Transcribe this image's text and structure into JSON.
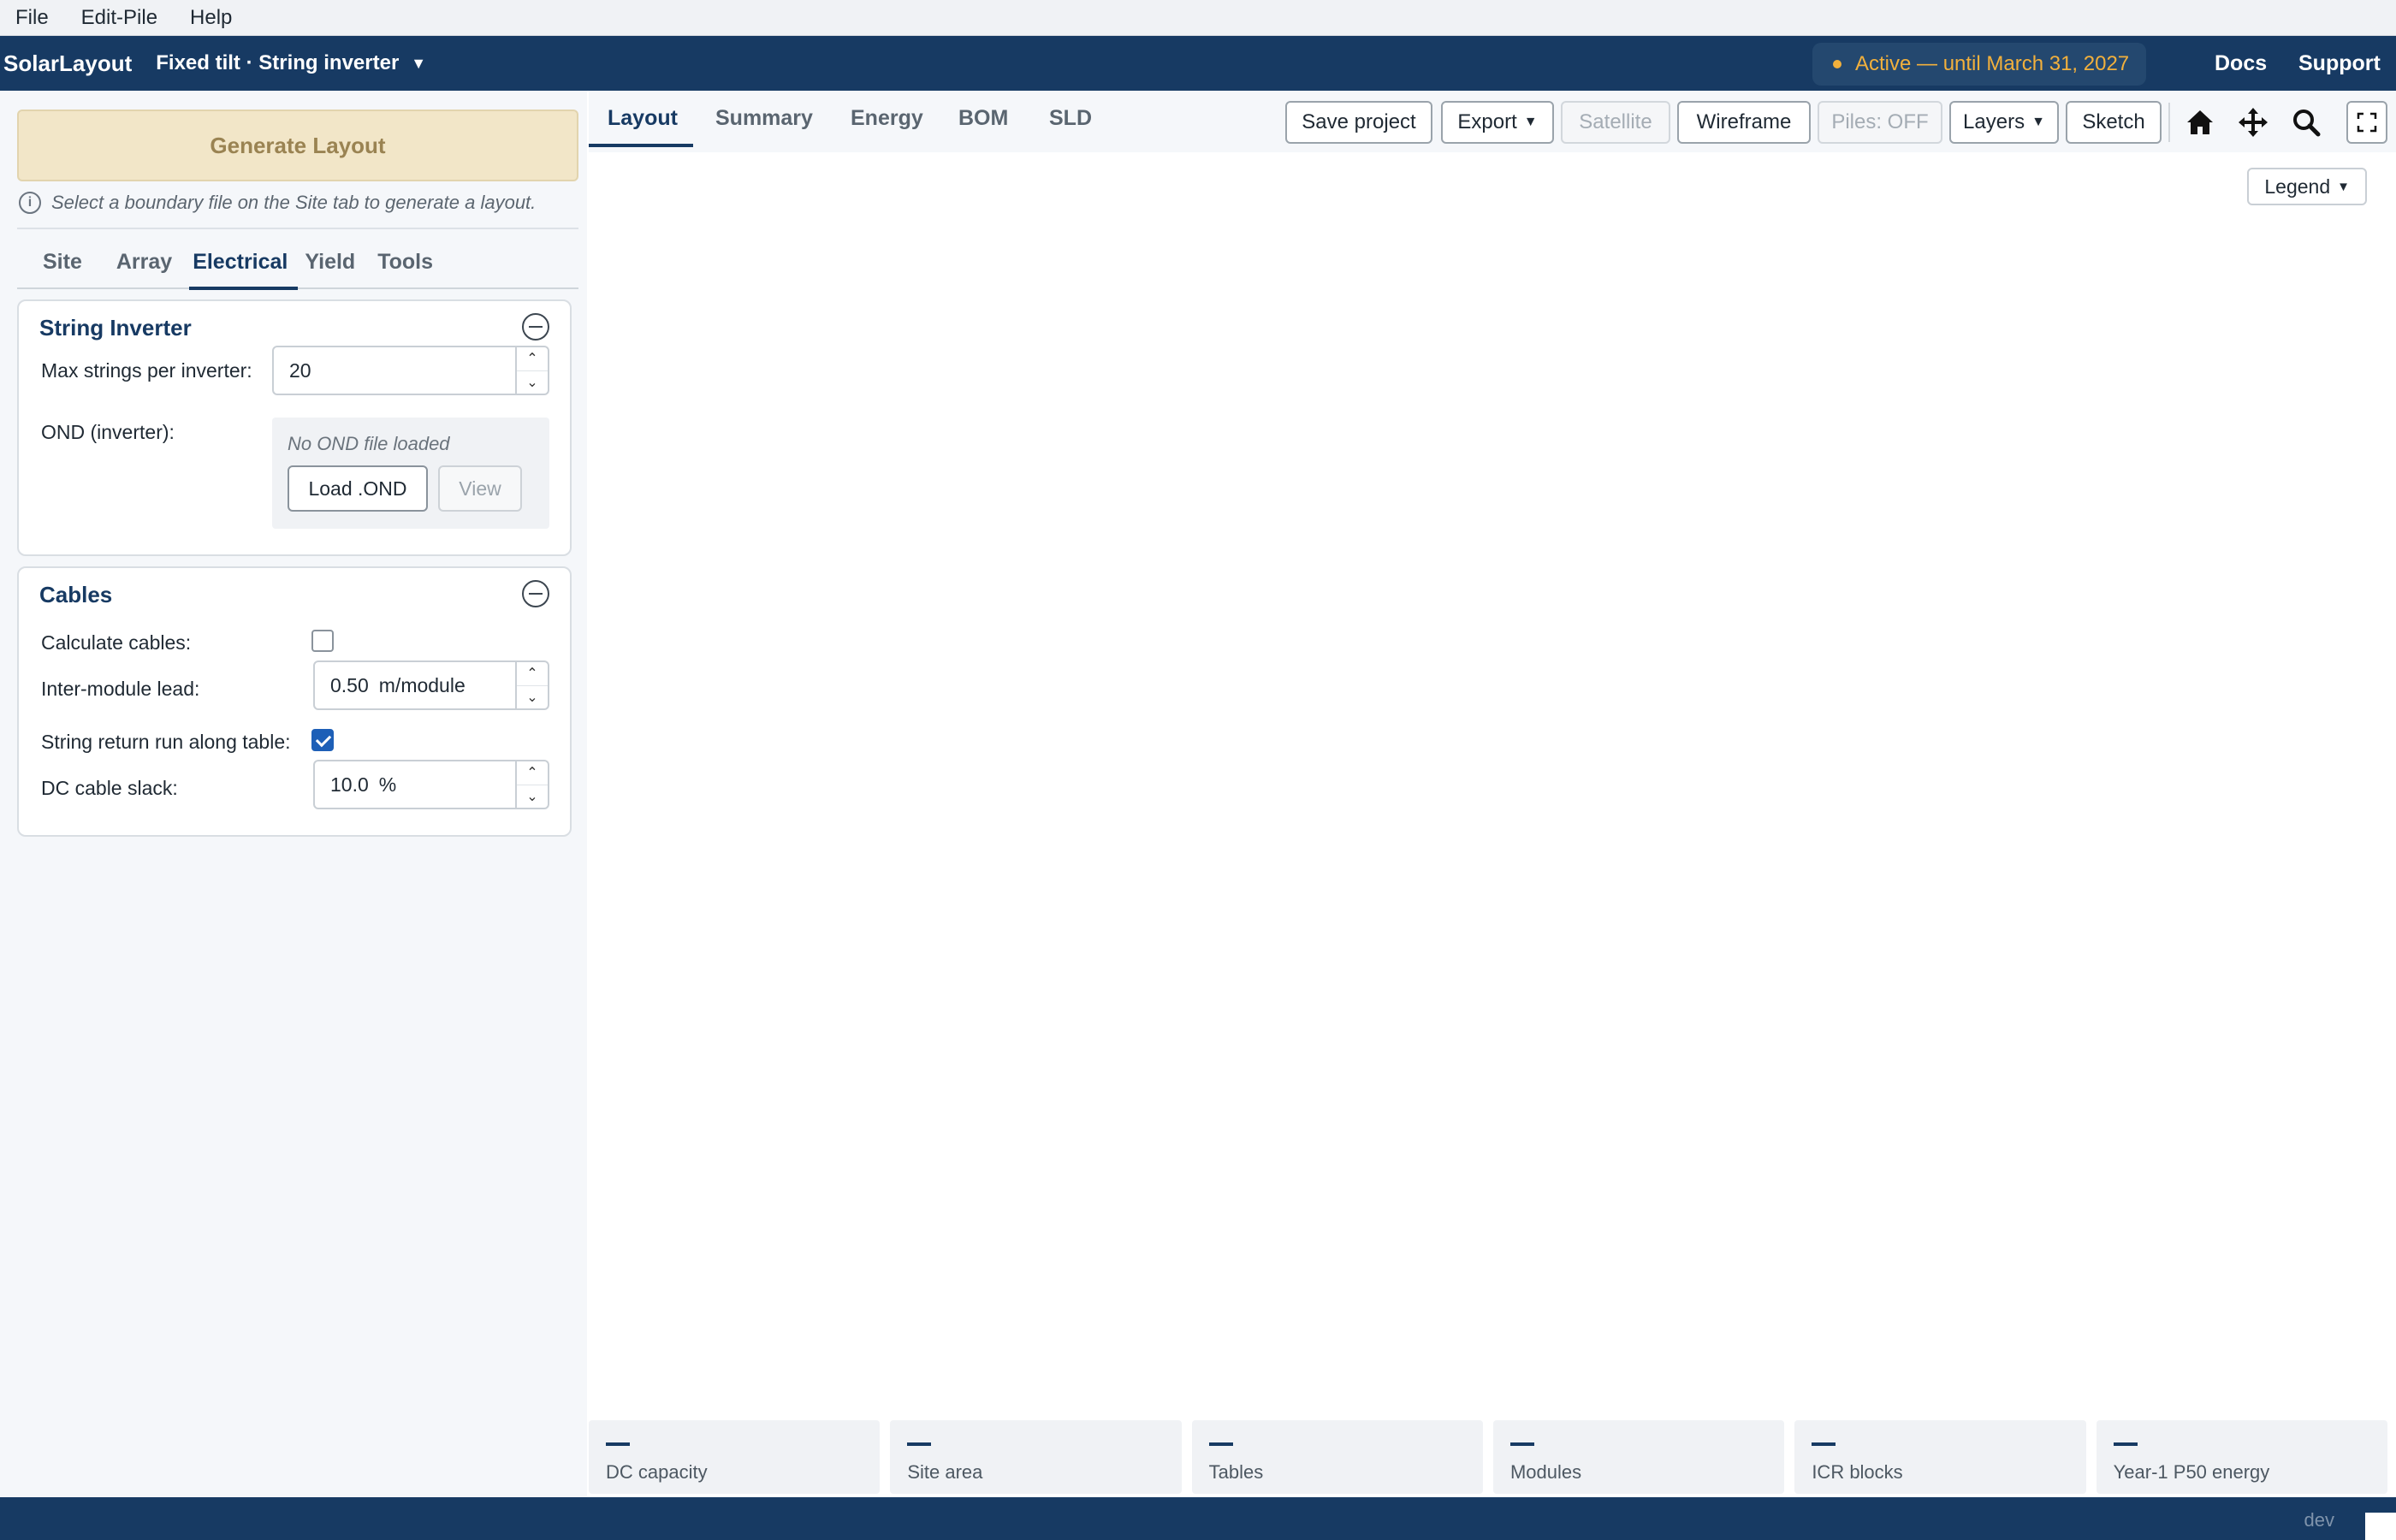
{
  "menu": {
    "file": "File",
    "edit_pile": "Edit-Pile",
    "help": "Help"
  },
  "header": {
    "brand": "SolarLayout",
    "mode": "Fixed tilt · String inverter",
    "license": "Active — until March 31, 2027",
    "docs": "Docs",
    "support": "Support"
  },
  "left": {
    "generate": "Generate Layout",
    "hint": "Select a boundary file on the Site tab to generate a layout.",
    "tabs": [
      "Site",
      "Array",
      "Electrical",
      "Yield",
      "Tools"
    ],
    "active_tab": "Electrical",
    "string_inverter": {
      "title": "String Inverter",
      "max_strings_label": "Max strings per inverter:",
      "max_strings_value": "20",
      "ond_label": "OND (inverter):",
      "ond_status": "No OND file loaded",
      "load_btn": "Load .OND",
      "view_btn": "View"
    },
    "cables": {
      "title": "Cables",
      "calc_label": "Calculate cables:",
      "calc_checked": false,
      "lead_label": "Inter-module lead:",
      "lead_value": "0.50",
      "lead_unit": "m/module",
      "return_label": "String return run along table:",
      "return_checked": true,
      "slack_label": "DC cable slack:",
      "slack_value": "10.0",
      "slack_unit": "%"
    }
  },
  "main": {
    "tabs": [
      "Layout",
      "Summary",
      "Energy",
      "BOM",
      "SLD"
    ],
    "active_tab": "Layout",
    "toolbar": {
      "save": "Save project",
      "export": "Export",
      "satellite": "Satellite",
      "wireframe": "Wireframe",
      "piles": "Piles: OFF",
      "layers": "Layers",
      "sketch": "Sketch"
    },
    "legend": "Legend",
    "stats": [
      "DC capacity",
      "Site area",
      "Tables",
      "Modules",
      "ICR blocks",
      "Year-1 P50 energy"
    ]
  },
  "footer": {
    "env": "dev"
  },
  "colors": {
    "navy": "#173a63",
    "accent": "#f2b03c",
    "generate_bg": "#f2e6c8"
  }
}
